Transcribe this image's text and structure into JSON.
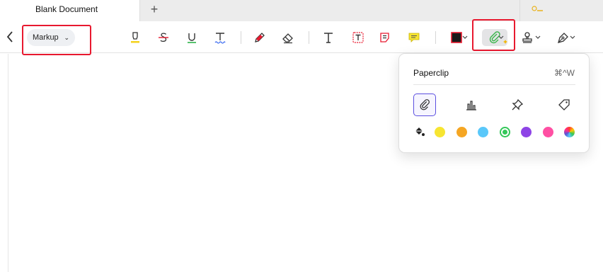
{
  "tabs": [
    {
      "label": "Blank Document"
    }
  ],
  "new_tab_label": "+",
  "toolbar": {
    "mode_label": "Markup",
    "tools": [
      "highlight",
      "strikethrough",
      "underline",
      "squiggly",
      "pencil",
      "eraser",
      "text",
      "text-box",
      "note",
      "comment"
    ]
  },
  "popover": {
    "title": "Paperclip",
    "shortcut": "⌘^W",
    "icons": [
      "paperclip",
      "graph",
      "pushpin",
      "tag"
    ],
    "colors": [
      "#f7e531",
      "#f5a623",
      "#5ac8fa",
      "#34c759",
      "#8e44e6",
      "#ff4fa3"
    ]
  },
  "colors": {
    "highlight_frame": "#e8192f",
    "accent_selection": "#5b4fe0"
  }
}
